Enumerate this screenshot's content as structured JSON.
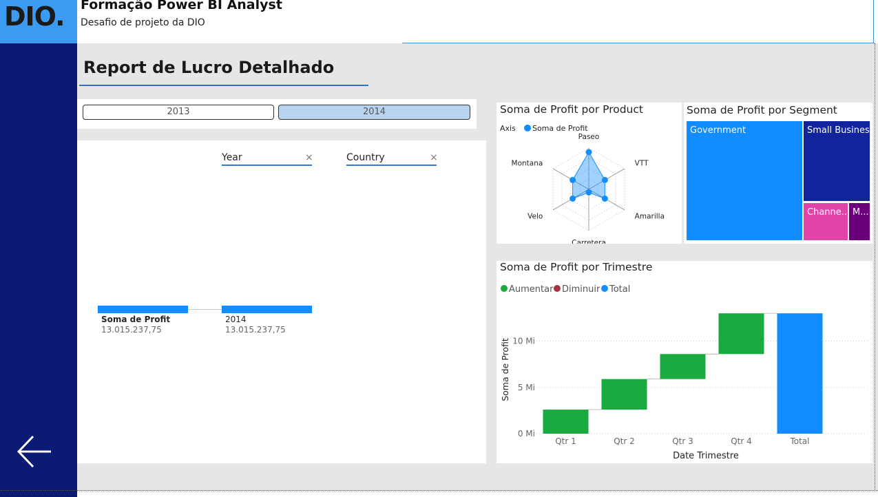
{
  "header": {
    "logo_text": "DIO.",
    "title": "Formação Power BI Analyst",
    "subtitle": "Desafio de projeto da DIO"
  },
  "colors": {
    "sidebar": "#0b1b74",
    "logo_bg": "#3a9bf0",
    "canvas": "#e6e6e6",
    "accent_blue": "#118dff",
    "increase_green": "#1aab40",
    "decrease_red": "#a1343c",
    "dark_navy": "#12239e",
    "pink": "#e044a7",
    "purple": "#6b007b",
    "slicer_selected": "#b8d3ee"
  },
  "report": {
    "title": "Report de Lucro Detalhado"
  },
  "year_slicer": {
    "options": [
      "2013",
      "2014"
    ],
    "selected": "2014"
  },
  "decomposition_tree": {
    "filters": [
      {
        "label": "Year",
        "remove_icon": "×"
      },
      {
        "label": "Country",
        "remove_icon": "×"
      }
    ],
    "nodes": [
      {
        "label": "Soma de Profit",
        "value": "13.015.237,75"
      },
      {
        "label": "2014",
        "value": "13.015.237,75"
      }
    ]
  },
  "radar_chart": {
    "title": "Soma de Profit por Product",
    "legend_axis_label": "Axis",
    "legend_series": "Soma de Profit"
  },
  "treemap": {
    "title": "Soma de Profit por Segment",
    "cells": [
      "Government",
      "Small Business",
      "Channe...",
      "M..."
    ]
  },
  "waterfall": {
    "title": "Soma de Profit por Trimestre",
    "legend": [
      "Aumentar",
      "Diminuir",
      "Total"
    ],
    "xlabel": "Date Trimestre",
    "ylabel": "Soma de Profit",
    "y_ticks": [
      "0 Mi",
      "5 Mi",
      "10 Mi"
    ]
  },
  "chart_data": [
    {
      "type": "radar",
      "title": "Soma de Profit por Product",
      "categories": [
        "Paseo",
        "VTT",
        "Amarilla",
        "Carretera",
        "Velo",
        "Montana"
      ],
      "series": [
        {
          "name": "Soma de Profit",
          "values": [
            3.6,
            1.8,
            1.8,
            0.3,
            1.8,
            1.8
          ]
        }
      ],
      "legend": "top-left"
    },
    {
      "type": "treemap",
      "title": "Soma de Profit por Segment",
      "categories": [
        "Government",
        "Small Business",
        "Channe...",
        "M..."
      ],
      "values": [
        6.7,
        3.3,
        1.2,
        0.6
      ]
    },
    {
      "type": "waterfall",
      "title": "Soma de Profit por Trimestre",
      "categories": [
        "Qtr 1",
        "Qtr 2",
        "Qtr 3",
        "Qtr 4",
        "Total"
      ],
      "series": [
        {
          "name": "Aumentar",
          "values": [
            2.6,
            3.3,
            2.7,
            4.4,
            null
          ]
        },
        {
          "name": "Total",
          "values": [
            null,
            null,
            null,
            null,
            13.0
          ]
        }
      ],
      "xlabel": "Date Trimestre",
      "ylabel": "Soma de Profit",
      "ylim": [
        0,
        14
      ],
      "y_unit": "Mi",
      "legend": "top-left"
    }
  ]
}
